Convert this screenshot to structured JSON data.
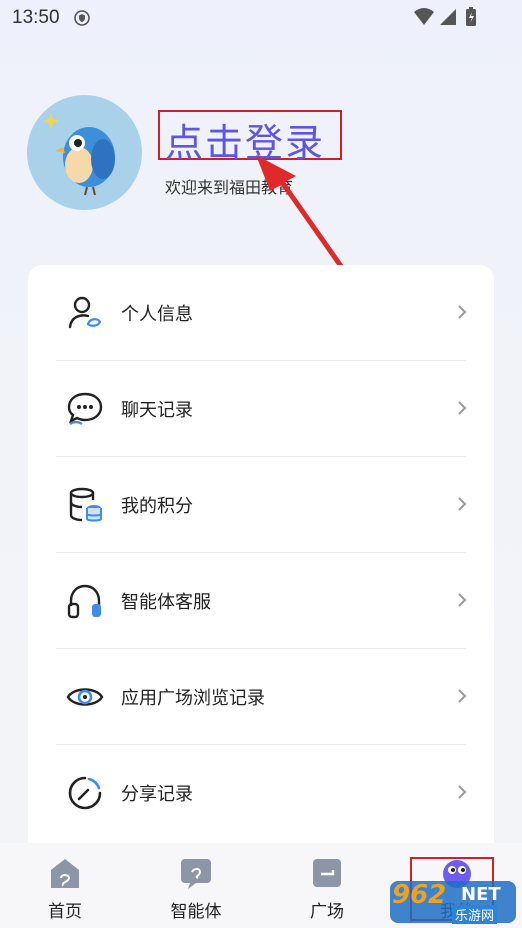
{
  "status": {
    "time": "13:50"
  },
  "profile": {
    "login_text": "点击登录",
    "welcome": "欢迎来到福田教育"
  },
  "menu": [
    {
      "label": "个人信息",
      "icon": "person-icon"
    },
    {
      "label": "聊天记录",
      "icon": "chat-icon"
    },
    {
      "label": "我的积分",
      "icon": "database-icon"
    },
    {
      "label": "智能体客服",
      "icon": "headphones-icon"
    },
    {
      "label": "应用广场浏览记录",
      "icon": "eye-icon"
    },
    {
      "label": "分享记录",
      "icon": "share-progress-icon"
    }
  ],
  "tabs": [
    {
      "label": "首页",
      "icon": "home-icon"
    },
    {
      "label": "智能体",
      "icon": "agent-icon"
    },
    {
      "label": "广场",
      "icon": "square-icon"
    },
    {
      "label": "我的",
      "icon": "mine-icon"
    }
  ],
  "watermark": {
    "brand": "962",
    "suffix": "NET",
    "sub": "乐游网"
  },
  "colors": {
    "accent": "#5f55e0",
    "highlight": "#d21f27"
  }
}
